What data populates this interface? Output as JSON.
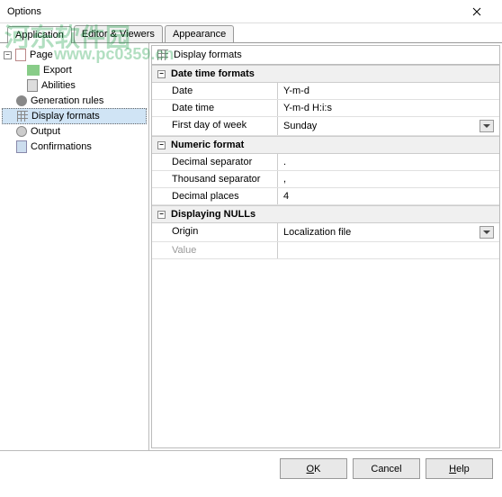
{
  "window": {
    "title": "Options"
  },
  "watermark": {
    "text1": "河东软件园",
    "text2": "www.pc0359.cn"
  },
  "tabs": [
    {
      "label": "Application",
      "active": true
    },
    {
      "label": "Editor & Viewers",
      "active": false
    },
    {
      "label": "Appearance",
      "active": false
    }
  ],
  "tree": {
    "root": {
      "label": "Page"
    },
    "children": [
      {
        "label": "Export"
      },
      {
        "label": "Abilities"
      }
    ],
    "siblings": [
      {
        "label": "Generation rules"
      },
      {
        "label": "Display formats",
        "selected": true
      },
      {
        "label": "Output"
      },
      {
        "label": "Confirmations"
      }
    ]
  },
  "panel": {
    "title": "Display formats",
    "groups": [
      {
        "title": "Date time formats",
        "rows": [
          {
            "label": "Date",
            "value": "Y-m-d",
            "dropdown": false
          },
          {
            "label": "Date time",
            "value": "Y-m-d H:i:s",
            "dropdown": false
          },
          {
            "label": "First day of week",
            "value": "Sunday",
            "dropdown": true
          }
        ]
      },
      {
        "title": "Numeric format",
        "rows": [
          {
            "label": "Decimal separator",
            "value": ".",
            "dropdown": false
          },
          {
            "label": "Thousand separator",
            "value": ",",
            "dropdown": false
          },
          {
            "label": "Decimal places",
            "value": "4",
            "dropdown": false
          }
        ]
      },
      {
        "title": "Displaying NULLs",
        "rows": [
          {
            "label": "Origin",
            "value": "Localization file",
            "dropdown": true
          },
          {
            "label": "Value",
            "value": "",
            "dropdown": false,
            "disabled": true
          }
        ]
      }
    ]
  },
  "buttons": {
    "ok": "OK",
    "cancel": "Cancel",
    "help": "Help"
  },
  "chart_data": {
    "type": "table",
    "title": "Display formats",
    "series": [
      {
        "name": "Date time formats",
        "rows": [
          [
            "Date",
            "Y-m-d"
          ],
          [
            "Date time",
            "Y-m-d H:i:s"
          ],
          [
            "First day of week",
            "Sunday"
          ]
        ]
      },
      {
        "name": "Numeric format",
        "rows": [
          [
            "Decimal separator",
            "."
          ],
          [
            "Thousand separator",
            ","
          ],
          [
            "Decimal places",
            "4"
          ]
        ]
      },
      {
        "name": "Displaying NULLs",
        "rows": [
          [
            "Origin",
            "Localization file"
          ],
          [
            "Value",
            ""
          ]
        ]
      }
    ]
  }
}
